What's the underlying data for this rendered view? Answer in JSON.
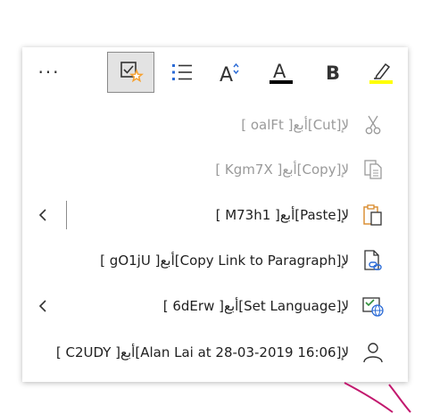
{
  "toolbar": {
    "more_label": "···",
    "colors": {
      "font_color_bar": "#000000",
      "highlight_bar": "#ffff00",
      "format_star": "#f7a130",
      "pressed_bg": "#e3e3e3"
    },
    "buttons": [
      {
        "name": "more",
        "icon": "more-dots-icon"
      },
      {
        "name": "styles",
        "icon": "checkbox-star-icon",
        "pressed": true
      },
      {
        "name": "list",
        "icon": "bullet-list-icon"
      },
      {
        "name": "font-size",
        "icon": "font-size-icon",
        "glyph": "A"
      },
      {
        "name": "font-color",
        "icon": "font-color-icon",
        "glyph": "A"
      },
      {
        "name": "bold",
        "icon": "bold-icon",
        "glyph": "B"
      },
      {
        "name": "highlight",
        "icon": "highlighter-icon"
      }
    ]
  },
  "menu": {
    "items": [
      {
        "label": "[ oalFt ]أبع[Cut]لإ",
        "icon": "scissors-icon",
        "enabled": false,
        "submenu": false
      },
      {
        "label": "[ Kgm7X ]أبع[Copy]لإ",
        "icon": "copy-icon",
        "enabled": false,
        "submenu": false
      },
      {
        "label": "[ M73h1 ]أبع[Paste]لإ",
        "icon": "paste-icon",
        "enabled": true,
        "submenu": true
      },
      {
        "label": "[ gO1jU ]أبع[Copy Link to Paragraph]لإ",
        "icon": "link-document-icon",
        "enabled": true,
        "submenu": false
      },
      {
        "label": "[ 6dErw ]أبع[Set Language]لإ",
        "icon": "language-globe-icon",
        "enabled": true,
        "submenu": true
      },
      {
        "label": "[ C2UDY ]أبع[Alan Lai at 28-03-2019 16:06]لإ",
        "icon": "person-icon",
        "enabled": true,
        "submenu": false
      }
    ]
  },
  "colors": {
    "accent_blue": "#2b6bd6",
    "paste_orange": "#d98a2b",
    "lang_green": "#2f8f3a",
    "pink_stroke": "#c2186e"
  }
}
